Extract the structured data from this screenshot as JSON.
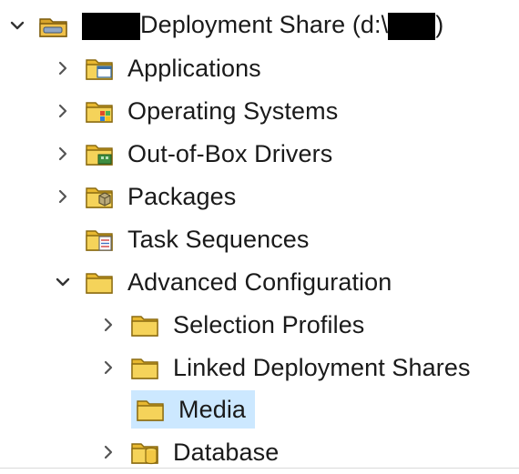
{
  "colors": {
    "selection": "#cce8ff",
    "folder_fill": "#f2c744",
    "folder_edge": "#8a6a10",
    "chevron": "#555555"
  },
  "tree": {
    "root": {
      "prefix": "",
      "label": "Deployment Share (d:\\",
      "suffix": ")",
      "icon": "deployment-share-icon",
      "expanded": true
    },
    "items": [
      {
        "label": "Applications",
        "icon": "applications-folder-icon",
        "expander": "collapsed"
      },
      {
        "label": "Operating Systems",
        "icon": "operating-systems-folder-icon",
        "expander": "collapsed"
      },
      {
        "label": "Out-of-Box Drivers",
        "icon": "drivers-folder-icon",
        "expander": "collapsed"
      },
      {
        "label": "Packages",
        "icon": "packages-folder-icon",
        "expander": "collapsed"
      },
      {
        "label": "Task Sequences",
        "icon": "task-sequences-folder-icon",
        "expander": "none"
      },
      {
        "label": "Advanced Configuration",
        "icon": "folder-icon",
        "expander": "expanded"
      }
    ],
    "advanced_children": [
      {
        "label": "Selection Profiles",
        "icon": "folder-icon",
        "expander": "collapsed"
      },
      {
        "label": "Linked Deployment Shares",
        "icon": "folder-icon",
        "expander": "collapsed"
      },
      {
        "label": "Media",
        "icon": "folder-icon",
        "expander": "none",
        "selected": true
      },
      {
        "label": "Database",
        "icon": "database-folder-icon",
        "expander": "collapsed"
      }
    ]
  }
}
